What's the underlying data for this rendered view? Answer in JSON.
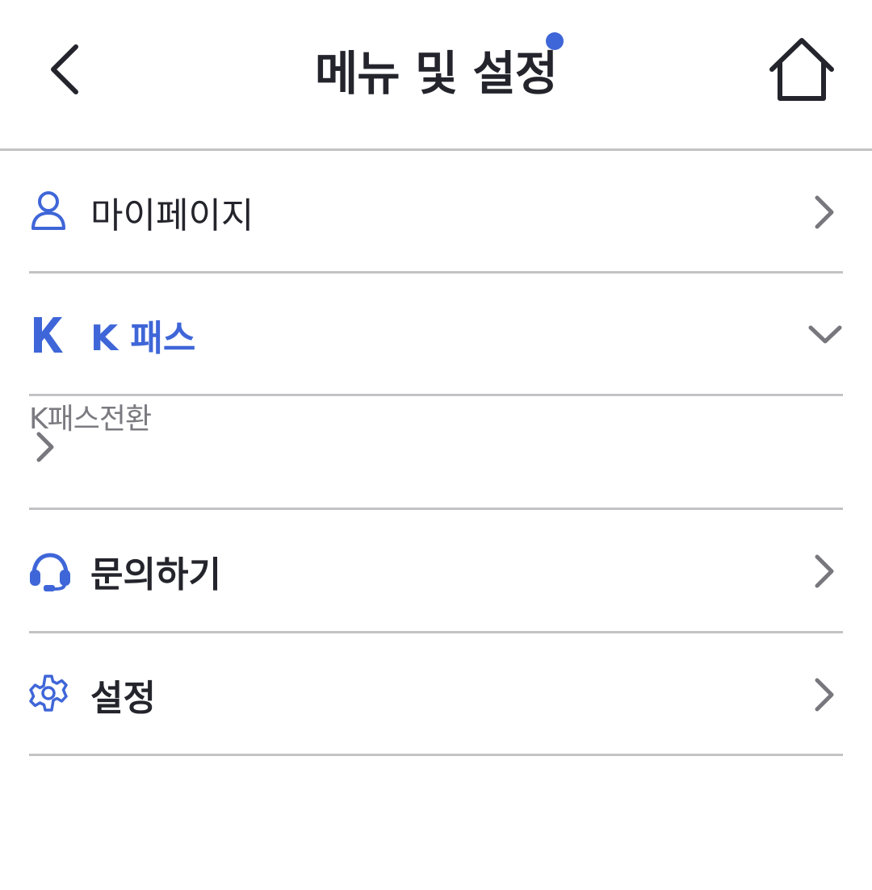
{
  "header": {
    "title": "메뉴 및 설정",
    "back_icon": "chevron-left-icon",
    "home_icon": "home-icon",
    "notification_dot_color": "#3f66d8"
  },
  "menu": {
    "mypage": {
      "label": "마이페이지",
      "icon": "person-icon",
      "indicator": "chevron-right-icon"
    },
    "kpass": {
      "label": "K 패스",
      "icon": "k-logo-icon",
      "indicator": "chevron-down-icon",
      "expanded": true
    },
    "kpass_sub": {
      "label": "K패스전환",
      "indicator": "chevron-right-icon"
    },
    "inquiry": {
      "label": "문의하기",
      "icon": "headset-icon",
      "indicator": "chevron-right-icon"
    },
    "settings": {
      "label": "설정",
      "icon": "gear-icon",
      "indicator": "chevron-right-icon"
    }
  },
  "colors": {
    "accent": "#3f66d8",
    "text": "#24242c",
    "divider": "#c3c3c6",
    "chevron": "#77777d",
    "sub_text": "#7a7a80"
  }
}
